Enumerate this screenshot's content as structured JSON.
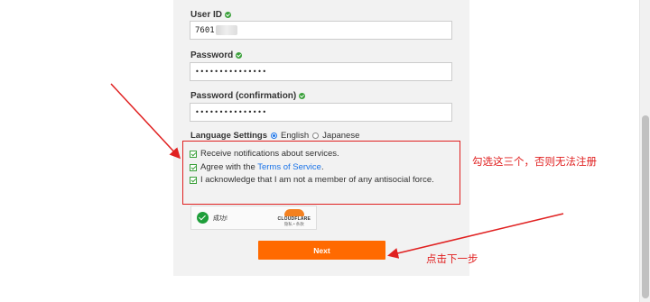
{
  "form": {
    "user_id": {
      "label": "User ID",
      "value": "7601"
    },
    "password": {
      "label": "Password",
      "value": "•••••••••••••••"
    },
    "password_confirm": {
      "label": "Password (confirmation)",
      "value": "•••••••••••••••"
    },
    "language": {
      "label": "Language Settings",
      "options": [
        "English",
        "Japanese"
      ],
      "selected": "English"
    },
    "checkboxes": {
      "notifications": "Receive notifications about services.",
      "terms_prefix": "Agree with the ",
      "terms_link": "Terms of Service",
      "terms_suffix": ".",
      "antisocial": "I acknowledge that I am not a member of any antisocial force."
    },
    "captcha": {
      "status": "成功!",
      "brand": "CLOUDFLARE",
      "links": "隐私 • 条款"
    },
    "next_label": "Next"
  },
  "annotations": {
    "checkbox_note": "勾选这三个，否则无法注册",
    "next_note": "点击下一步",
    "color": "#e02020"
  },
  "colors": {
    "accent_button": "#ff6a00",
    "check_green": "#3aa03a",
    "link": "#1a73e8"
  }
}
